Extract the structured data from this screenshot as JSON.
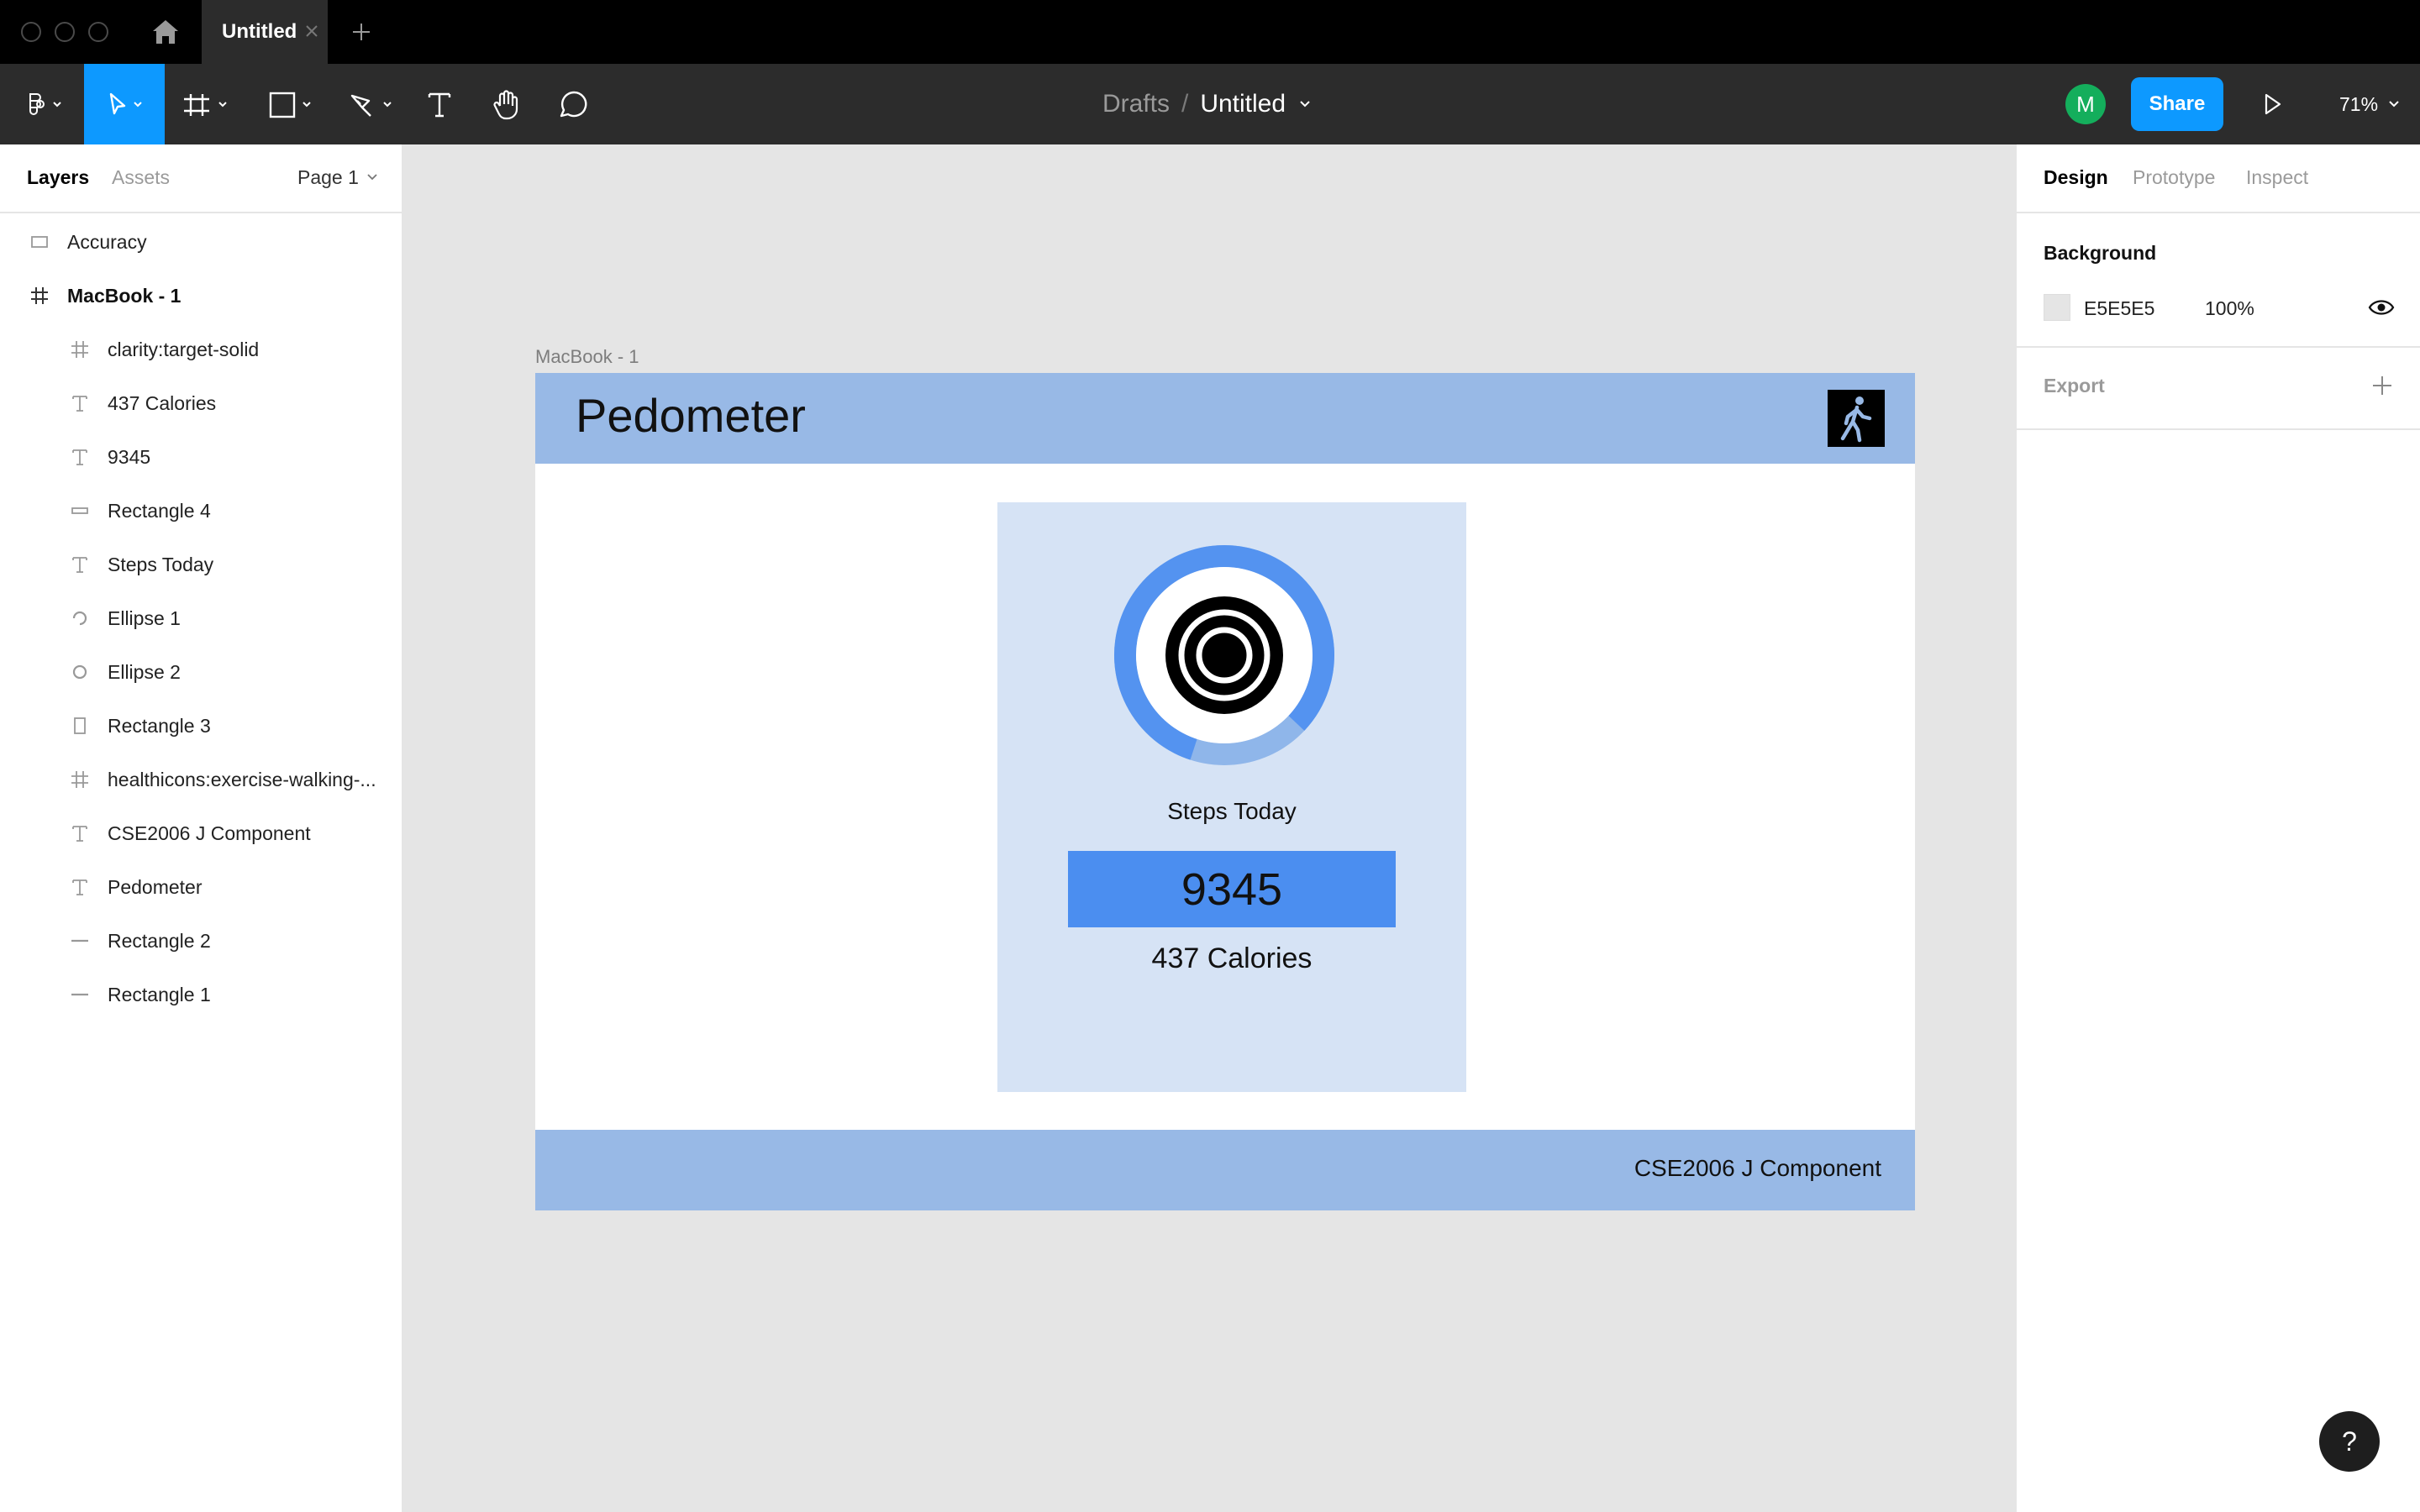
{
  "window": {
    "tab_title": "Untitled"
  },
  "toolbar": {
    "breadcrumb_parent": "Drafts",
    "breadcrumb_separator": "/",
    "file_name": "Untitled",
    "avatar_initial": "M",
    "share_label": "Share",
    "zoom_level": "71%"
  },
  "left_panel": {
    "tab_layers": "Layers",
    "tab_assets": "Assets",
    "page_selector": "Page 1",
    "layers": [
      {
        "name": "Accuracy",
        "icon": "rectangle-icon"
      },
      {
        "name": "MacBook - 1",
        "icon": "frame-icon"
      },
      {
        "name": "clarity:target-solid",
        "icon": "frame-icon"
      },
      {
        "name": "437 Calories",
        "icon": "text-icon"
      },
      {
        "name": "9345",
        "icon": "text-icon"
      },
      {
        "name": "Rectangle 4",
        "icon": "rectangle-icon"
      },
      {
        "name": "Steps Today",
        "icon": "text-icon"
      },
      {
        "name": "Ellipse 1",
        "icon": "arc-icon"
      },
      {
        "name": "Ellipse 2",
        "icon": "ellipse-icon"
      },
      {
        "name": "Rectangle 3",
        "icon": "rectangle-icon"
      },
      {
        "name": "healthicons:exercise-walking-...",
        "icon": "frame-icon"
      },
      {
        "name": "CSE2006 J Component",
        "icon": "text-icon"
      },
      {
        "name": "Pedometer",
        "icon": "text-icon"
      },
      {
        "name": "Rectangle 2",
        "icon": "line-icon"
      },
      {
        "name": "Rectangle 1",
        "icon": "line-icon"
      }
    ]
  },
  "right_panel": {
    "tab_design": "Design",
    "tab_prototype": "Prototype",
    "tab_inspect": "Inspect",
    "background_label": "Background",
    "background_hex": "E5E5E5",
    "background_opacity": "100%",
    "export_label": "Export"
  },
  "canvas": {
    "frame_label": "MacBook - 1",
    "app_title": "Pedometer",
    "steps_label": "Steps Today",
    "steps_count": "9345",
    "calories": "437 Calories",
    "footer_text": "CSE2006 J Component",
    "ring_progress": 0.82
  },
  "help_label": "?",
  "colors": {
    "accent": "#0d99ff",
    "header_blue": "#98b9e6",
    "card_blue": "#d6e3f5",
    "count_blue": "#4b8ef0",
    "ring_blue": "#5493f0",
    "ring_light": "#8fb6ea",
    "avatar_green": "#14ae5c"
  }
}
